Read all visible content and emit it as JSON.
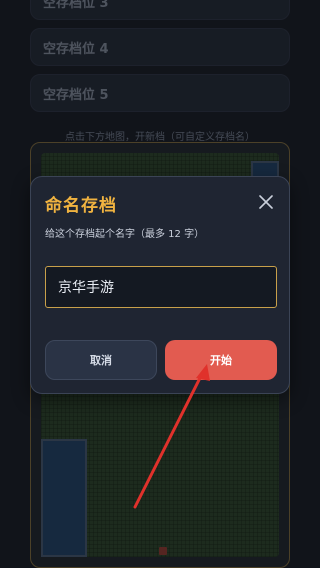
{
  "slots": [
    {
      "label": "空存档位 3"
    },
    {
      "label": "空存档位 4"
    },
    {
      "label": "空存档位 5"
    }
  ],
  "hint_text": "点击下方地图，开新档（可自定义存档名）",
  "modal": {
    "title": "命名存档",
    "subtitle": "给这个存档起个名字（最多 12 字）",
    "input_value": "京华手游",
    "cancel_label": "取消",
    "start_label": "开始",
    "close_icon": "close-icon"
  },
  "colors": {
    "accent_gold": "#f0b340",
    "start_button": "#e25b50",
    "annotation_arrow": "#e0312b"
  }
}
